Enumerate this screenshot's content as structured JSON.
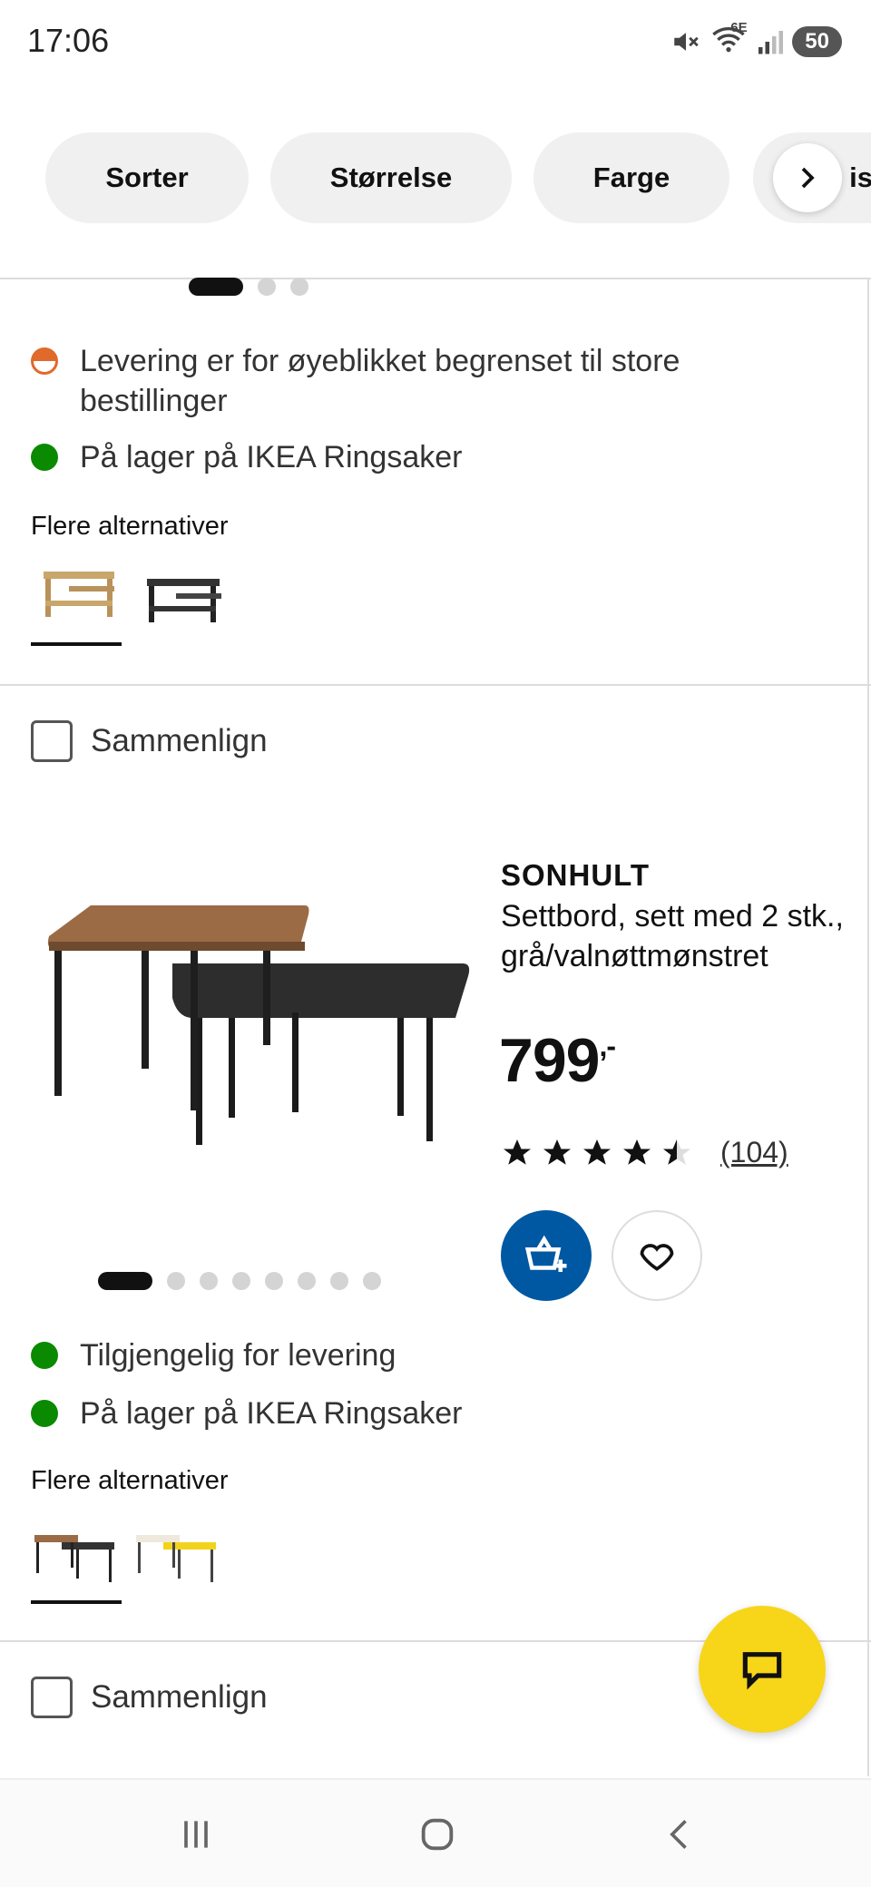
{
  "status": {
    "time": "17:06",
    "battery": "50",
    "network": "6E"
  },
  "filters": {
    "chips": [
      "Sorter",
      "Størrelse",
      "Farge"
    ],
    "partial_chip": "is"
  },
  "product_prev": {
    "stock": [
      {
        "status": "limited",
        "text": "Levering er for øyeblikket begrenset til store bestillinger"
      },
      {
        "status": "in-stock",
        "text": "På lager på IKEA Ringsaker"
      }
    ],
    "more_options_label": "Flere alternativer"
  },
  "product_main": {
    "compare_label": "Sammenlign",
    "name": "SONHULT",
    "description": "Settbord, sett med 2 stk., grå/valnøttmønstret",
    "price": "799",
    "price_suffix": ",-",
    "rating": 4.5,
    "review_count": "(104)",
    "image_count": 8,
    "active_image": 1,
    "stock": [
      {
        "status": "in-stock",
        "text": "Tilgjengelig for levering"
      },
      {
        "status": "in-stock",
        "text": "På lager på IKEA Ringsaker"
      }
    ],
    "more_options_label": "Flere alternativer"
  },
  "product_next": {
    "compare_label": "Sammenlign"
  },
  "colors": {
    "accent_blue": "#0058a3",
    "chat_yellow": "#f7d519",
    "in_stock_green": "#0a8a00",
    "limited_orange": "#e06a2b"
  },
  "icons": {
    "add_to_cart": "shopping-bag-plus-icon",
    "favorite": "heart-icon",
    "chat": "chat-bubble-icon",
    "next": "chevron-right-icon"
  }
}
